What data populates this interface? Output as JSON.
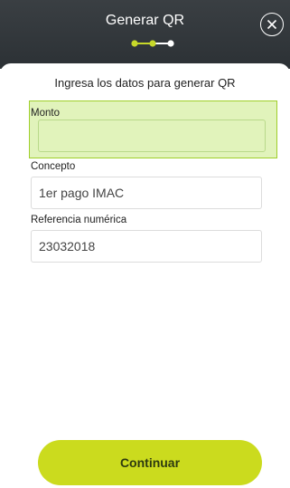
{
  "header": {
    "title": "Generar QR",
    "close_icon": "close-circle-icon",
    "stepper": {
      "total_steps": 3,
      "current_step": 2,
      "active_color": "#c7d82a",
      "inactive_color": "#ffffff"
    }
  },
  "form": {
    "subtitle": "Ingresa los datos para generar QR",
    "highlight_color": "#a8d83c",
    "fields": {
      "monto": {
        "label": "Monto",
        "value": ""
      },
      "concepto": {
        "label": "Concepto",
        "value": "1er pago IMAC"
      },
      "referencia": {
        "label": "Referencia numérica",
        "value": "23032018"
      }
    }
  },
  "footer": {
    "continue_label": "Continuar",
    "button_color": "#cbdb1e"
  }
}
